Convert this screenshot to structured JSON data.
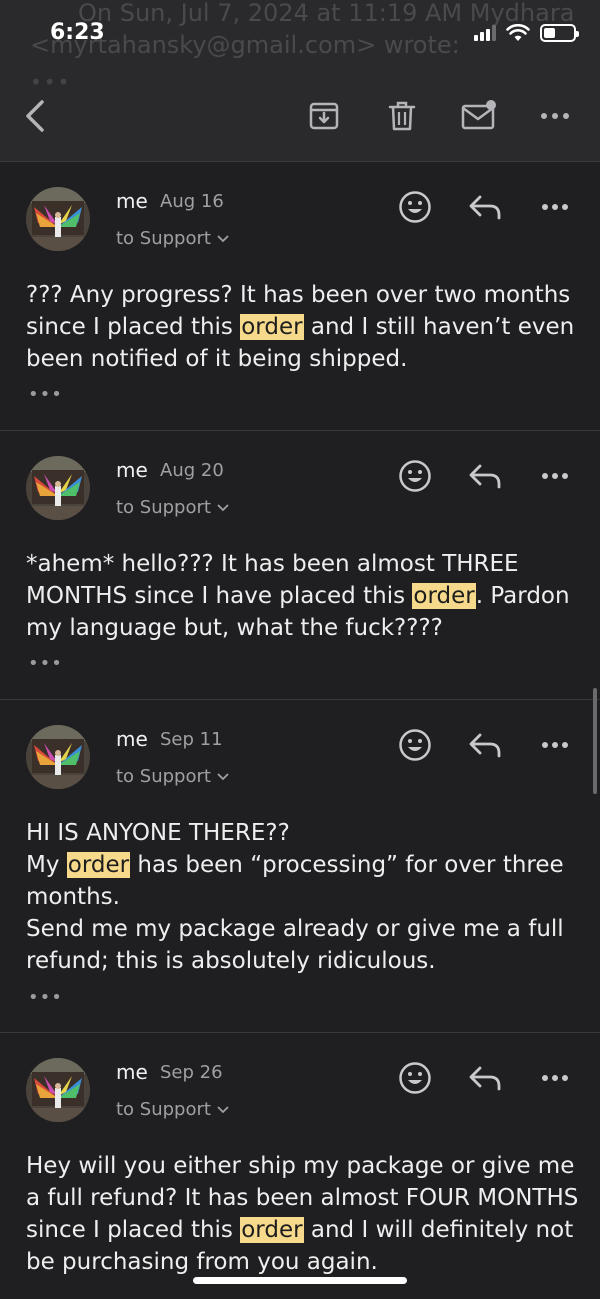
{
  "status_bar": {
    "time": "6:23"
  },
  "background_text": {
    "line1": "On Sun, Jul 7, 2024 at 11:19 AM Mydhara",
    "line2": "<myrtahansky@gmail.com> wrote:"
  },
  "toolbar": {
    "icons": [
      "back-chevron-icon",
      "archive-icon",
      "trash-icon",
      "mark-unread-icon",
      "more-icon"
    ]
  },
  "messages": [
    {
      "sender": "me",
      "date": "Aug 16",
      "to": "to Support",
      "body": [
        {
          "t": "??? Any progress? It has been over two months since I placed this "
        },
        {
          "t": "order",
          "hl": true
        },
        {
          "t": " and I still haven’t even been notified of it being shipped."
        }
      ],
      "more": "•••"
    },
    {
      "sender": "me",
      "date": "Aug 20",
      "to": "to Support",
      "body": [
        {
          "t": "*ahem* hello??? It has been almost THREE MONTHS since I have placed this "
        },
        {
          "t": "order",
          "hl": true
        },
        {
          "t": ". Pardon my language but, what the fuck????"
        }
      ],
      "more": "•••"
    },
    {
      "sender": "me",
      "date": "Sep 11",
      "to": "to Support",
      "body": [
        {
          "t": "HI IS ANYONE THERE??\nMy "
        },
        {
          "t": "order",
          "hl": true
        },
        {
          "t": " has been “processing” for over three months.\nSend me my package already or give me a full refund; this is absolutely ridiculous."
        }
      ],
      "more": "•••"
    },
    {
      "sender": "me",
      "date": "Sep 26",
      "to": "to Support",
      "body": [
        {
          "t": "Hey will you either ship my package or give me a full refund? It has been almost FOUR MONTHS since I placed this "
        },
        {
          "t": "order",
          "hl": true
        },
        {
          "t": " and I will definitely not be purchasing from you again."
        }
      ],
      "more": ""
    }
  ],
  "colors": {
    "background": "#1f1f21",
    "highlight": "#f6d98b",
    "muted_text": "#a0a0a4"
  }
}
